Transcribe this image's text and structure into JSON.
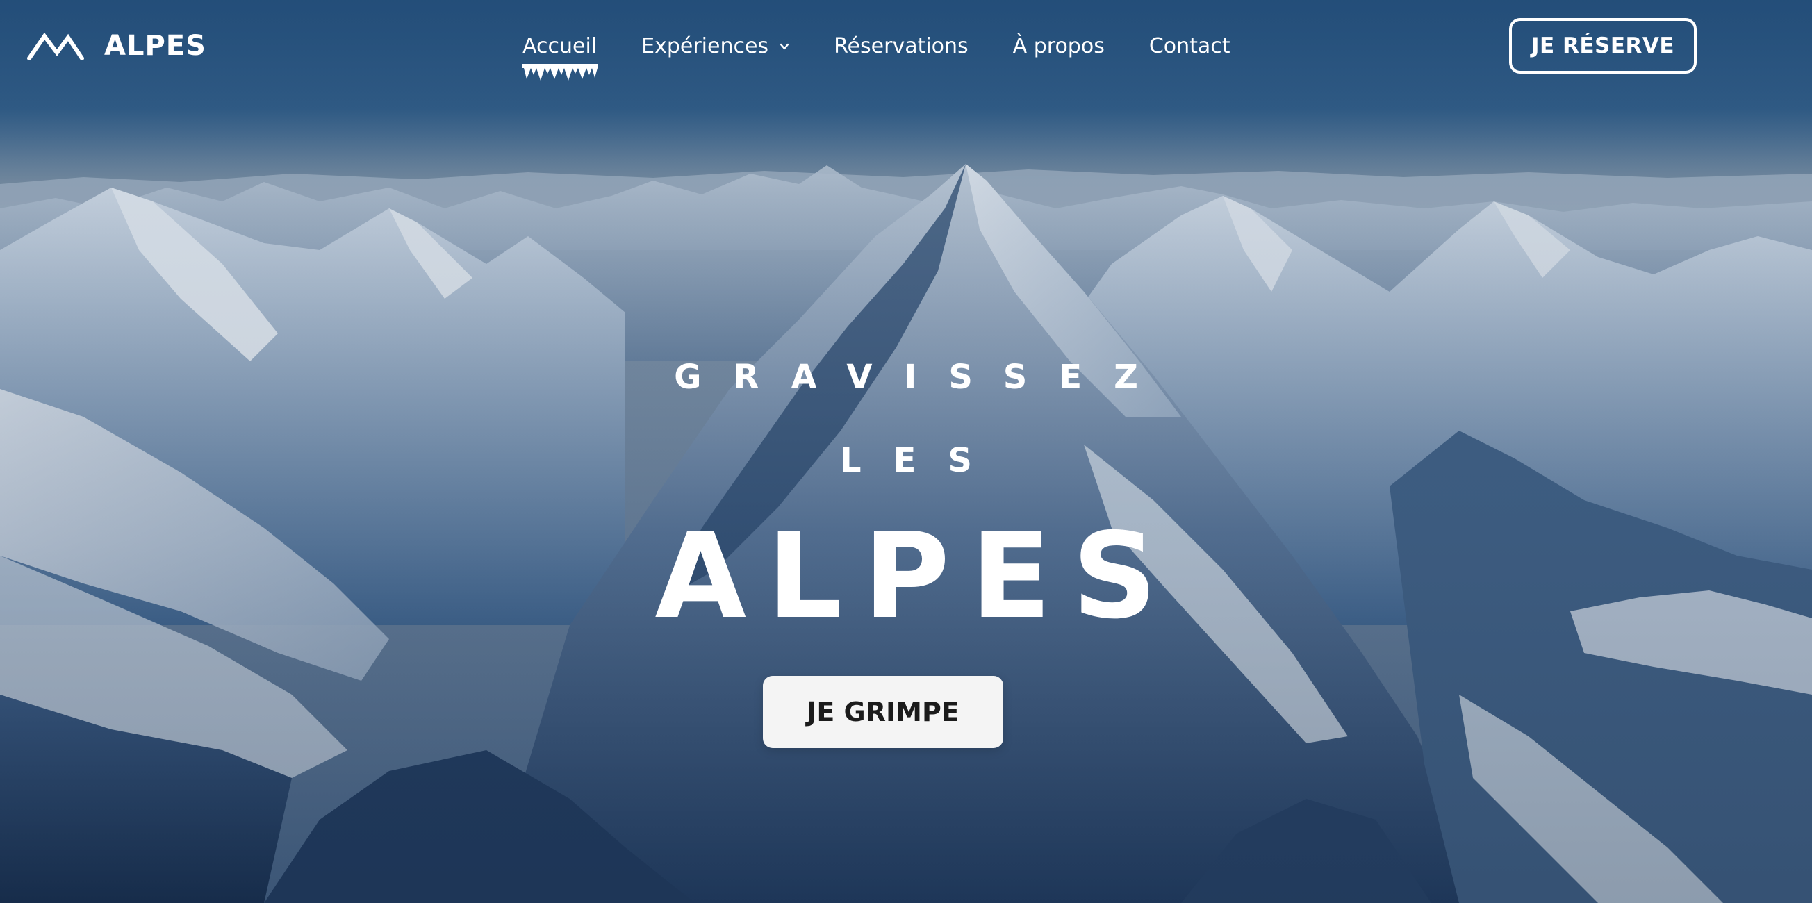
{
  "brand": {
    "name": "ALPES",
    "logo_icon": "mountain-icon"
  },
  "nav": {
    "items": [
      {
        "label": "Accueil",
        "active": true
      },
      {
        "label": "Expériences",
        "has_dropdown": true
      },
      {
        "label": "Réservations"
      },
      {
        "label": "À propos"
      },
      {
        "label": "Contact"
      }
    ]
  },
  "header": {
    "cta_label": "JE RÉSERVE"
  },
  "hero": {
    "line1": "GRAVISSEZ",
    "line2": "LES",
    "title": "ALPES",
    "cta_label": "JE GRIMPE",
    "background": "snowy-mountains-image"
  },
  "colors": {
    "sky_top": "#2b5983",
    "sky_horizon": "#7f93a6",
    "snow": "#e9eef4",
    "shadow": "#1e3556",
    "cta_bg": "#f4f4f4",
    "cta_text": "#1b1b1b"
  }
}
